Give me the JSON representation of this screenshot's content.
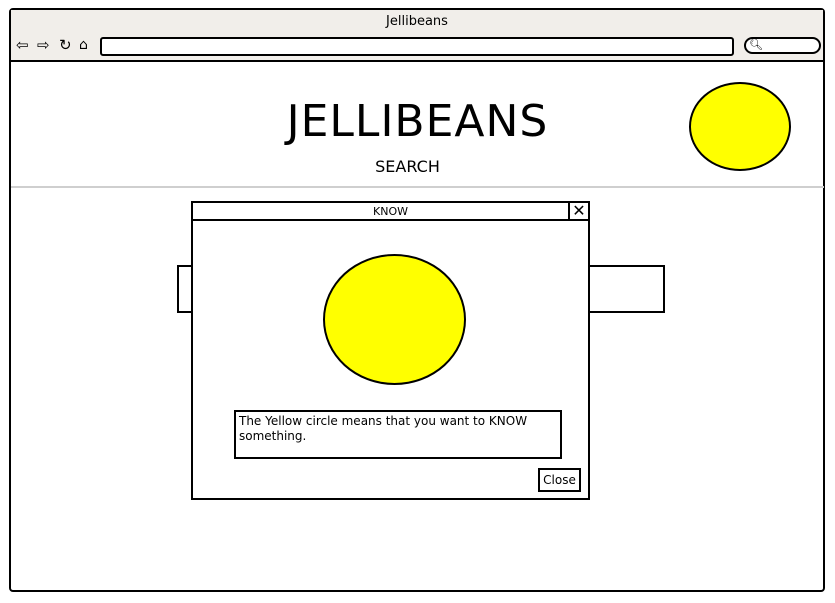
{
  "window": {
    "title": "Jellibeans"
  },
  "toolbar": {
    "back_icon": "back-arrow-icon",
    "forward_icon": "forward-arrow-icon",
    "reload_icon": "reload-icon",
    "home_icon": "home-icon",
    "address_value": "",
    "search_icon": "search-icon"
  },
  "header": {
    "title": "JELLIBEANS",
    "search_label": "SEARCH"
  },
  "colors": {
    "circle_fill": "#ffff00",
    "chrome_bg": "#f1eeea",
    "divider": "#cfcfcf"
  },
  "dialog": {
    "title": "KNOW",
    "message": "The Yellow circle means that you want to KNOW something.",
    "close_label": "Close"
  }
}
